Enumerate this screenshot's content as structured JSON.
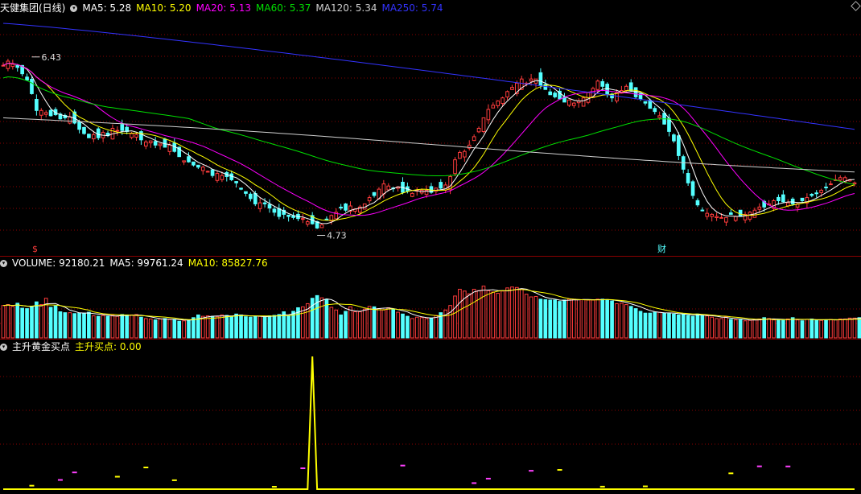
{
  "main_panel": {
    "title": "天健集团(日线)",
    "ma_labels": [
      {
        "name": "MA5",
        "value": "5.28",
        "color": "#ffffff"
      },
      {
        "name": "MA10",
        "value": "5.20",
        "color": "#ffff00"
      },
      {
        "name": "MA20",
        "value": "5.13",
        "color": "#ff00ff"
      },
      {
        "name": "MA60",
        "value": "5.37",
        "color": "#00e000"
      },
      {
        "name": "MA120",
        "value": "5.34",
        "color": "#d0d0d0"
      },
      {
        "name": "MA250",
        "value": "5.74",
        "color": "#3333ff"
      }
    ],
    "high_label": "6.43",
    "low_label": "4.73",
    "marker_left": "$",
    "marker_cai": "财"
  },
  "volume_panel": {
    "label": "VOLUME: 92180.21",
    "ma5": "MA5: 99761.24",
    "ma10": "MA10: 85827.76"
  },
  "indicator_panel": {
    "title": "主升黄金买点",
    "value_label": "主升买点: 0.00"
  },
  "colors": {
    "up": "#ff3c3c",
    "down": "#54ffff",
    "grid": "#8b0000"
  },
  "chart_data": [
    {
      "type": "candlestick",
      "title": "天健集团(日线)",
      "yrange": [
        4.55,
        6.85
      ],
      "annotations": {
        "high": 6.43,
        "low": 4.73
      },
      "closes": [
        6.35,
        6.39,
        6.36,
        6.33,
        6.27,
        6.21,
        6.08,
        5.92,
        5.92,
        5.9,
        5.87,
        5.88,
        5.84,
        5.85,
        5.86,
        5.8,
        5.74,
        5.7,
        5.66,
        5.69,
        5.66,
        5.71,
        5.68,
        5.75,
        5.73,
        5.73,
        5.72,
        5.7,
        5.69,
        5.64,
        5.62,
        5.63,
        5.59,
        5.6,
        5.57,
        5.59,
        5.53,
        5.48,
        5.44,
        5.43,
        5.4,
        5.38,
        5.38,
        5.34,
        5.3,
        5.32,
        5.3,
        5.29,
        5.26,
        5.23,
        5.17,
        5.13,
        5.08,
        5.03,
        5.04,
        5.03,
        4.99,
        4.95,
        4.91,
        4.93,
        4.91,
        4.9,
        4.89,
        4.89,
        4.86,
        4.84,
        4.8,
        4.83,
        4.88,
        4.92,
        4.95,
        4.99,
        4.97,
        5.01,
        4.98,
        5.0,
        5.03,
        5.09,
        5.11,
        5.17,
        5.22,
        5.2,
        5.18,
        5.19,
        5.14,
        5.15,
        5.13,
        5.16,
        5.16,
        5.16,
        5.14,
        5.18,
        5.18,
        5.21,
        5.29,
        5.45,
        5.52,
        5.53,
        5.59,
        5.67,
        5.75,
        5.85,
        5.93,
        5.97,
        6.01,
        6.04,
        6.1,
        6.14,
        6.18,
        6.22,
        6.18,
        6.22,
        6.22,
        6.16,
        6.12,
        6.07,
        6.05,
        6.03,
        6.0,
        6.02,
        5.99,
        6.01,
        6.04,
        6.09,
        6.13,
        6.2,
        6.15,
        6.08,
        6.04,
        6.09,
        6.11,
        6.15,
        6.11,
        6.05,
        6.03,
        5.99,
        5.94,
        5.91,
        5.87,
        5.79,
        5.72,
        5.63,
        5.49,
        5.36,
        5.23,
        5.11,
        5.02,
        4.97,
        4.94,
        4.93,
        4.91,
        4.9,
        4.9,
        4.93,
        4.91,
        4.91,
        4.93,
        4.95,
        4.97,
        5.0,
        5.0,
        5.03,
        5.06,
        5.06,
        5.05,
        5.04,
        5.03,
        5.03,
        5.06,
        5.09,
        5.11,
        5.13,
        5.16,
        5.19,
        5.22,
        5.26,
        5.28,
        5.28,
        5.26,
        5.23
      ],
      "series": [
        {
          "name": "MA5",
          "value": 5.28,
          "color": "#ffffff"
        },
        {
          "name": "MA10",
          "value": 5.2,
          "color": "#ffff00"
        },
        {
          "name": "MA20",
          "value": 5.13,
          "color": "#ff00ff"
        },
        {
          "name": "MA60",
          "value": 5.37,
          "color": "#00e000"
        },
        {
          "name": "MA120",
          "value": 5.34,
          "color": "#d0d0d0"
        },
        {
          "name": "MA250",
          "value": 5.74,
          "color": "#3333ff"
        }
      ]
    },
    {
      "type": "bar",
      "title": "VOLUME",
      "ylim": [
        0,
        150000
      ],
      "current": 92180.21,
      "series": [
        {
          "name": "MA5",
          "value": 99761.24
        },
        {
          "name": "MA10",
          "value": 85827.76
        }
      ],
      "values": [
        72,
        74,
        70,
        77,
        66,
        65,
        70,
        80,
        74,
        88,
        68,
        71,
        58,
        56,
        56,
        54,
        55,
        55,
        57,
        49,
        48,
        50,
        48,
        50,
        48,
        52,
        51,
        51,
        52,
        46,
        43,
        42,
        40,
        42,
        43,
        41,
        41,
        37,
        38,
        40,
        45,
        51,
        48,
        49,
        48,
        47,
        51,
        50,
        48,
        53,
        51,
        47,
        46,
        48,
        48,
        47,
        49,
        50,
        52,
        58,
        49,
        59,
        67,
        69,
        76,
        88,
        94,
        89,
        86,
        68,
        62,
        51,
        59,
        69,
        58,
        58,
        64,
        70,
        69,
        65,
        62,
        67,
        63,
        57,
        53,
        48,
        43,
        46,
        45,
        43,
        44,
        50,
        56,
        62,
        72,
        93,
        108,
        104,
        98,
        108,
        105,
        115,
        105,
        102,
        99,
        104,
        111,
        113,
        112,
        108,
        97,
        91,
        92,
        86,
        85,
        84,
        84,
        81,
        84,
        86,
        86,
        85,
        85,
        84,
        84,
        86,
        86,
        85,
        82,
        76,
        77,
        74,
        70,
        65,
        59,
        55,
        55,
        57,
        57,
        55,
        54,
        53,
        51,
        53,
        50,
        48,
        53,
        50,
        49,
        46,
        43,
        43,
        47,
        41,
        40,
        40,
        38,
        39,
        41,
        42,
        45,
        43,
        40,
        39,
        39,
        42,
        45,
        40,
        38,
        41,
        42,
        40,
        39,
        40,
        41,
        40,
        42,
        42,
        44,
        44,
        45,
        45,
        44,
        43,
        46
      ]
    },
    {
      "type": "line",
      "title": "主升黄金买点",
      "ylim": [
        0,
        170
      ],
      "series": [
        {
          "name": "主升买点",
          "value": 0.0,
          "color": "#ffff00"
        }
      ],
      "spike_at_index": 65,
      "spike_value": 165
    }
  ]
}
